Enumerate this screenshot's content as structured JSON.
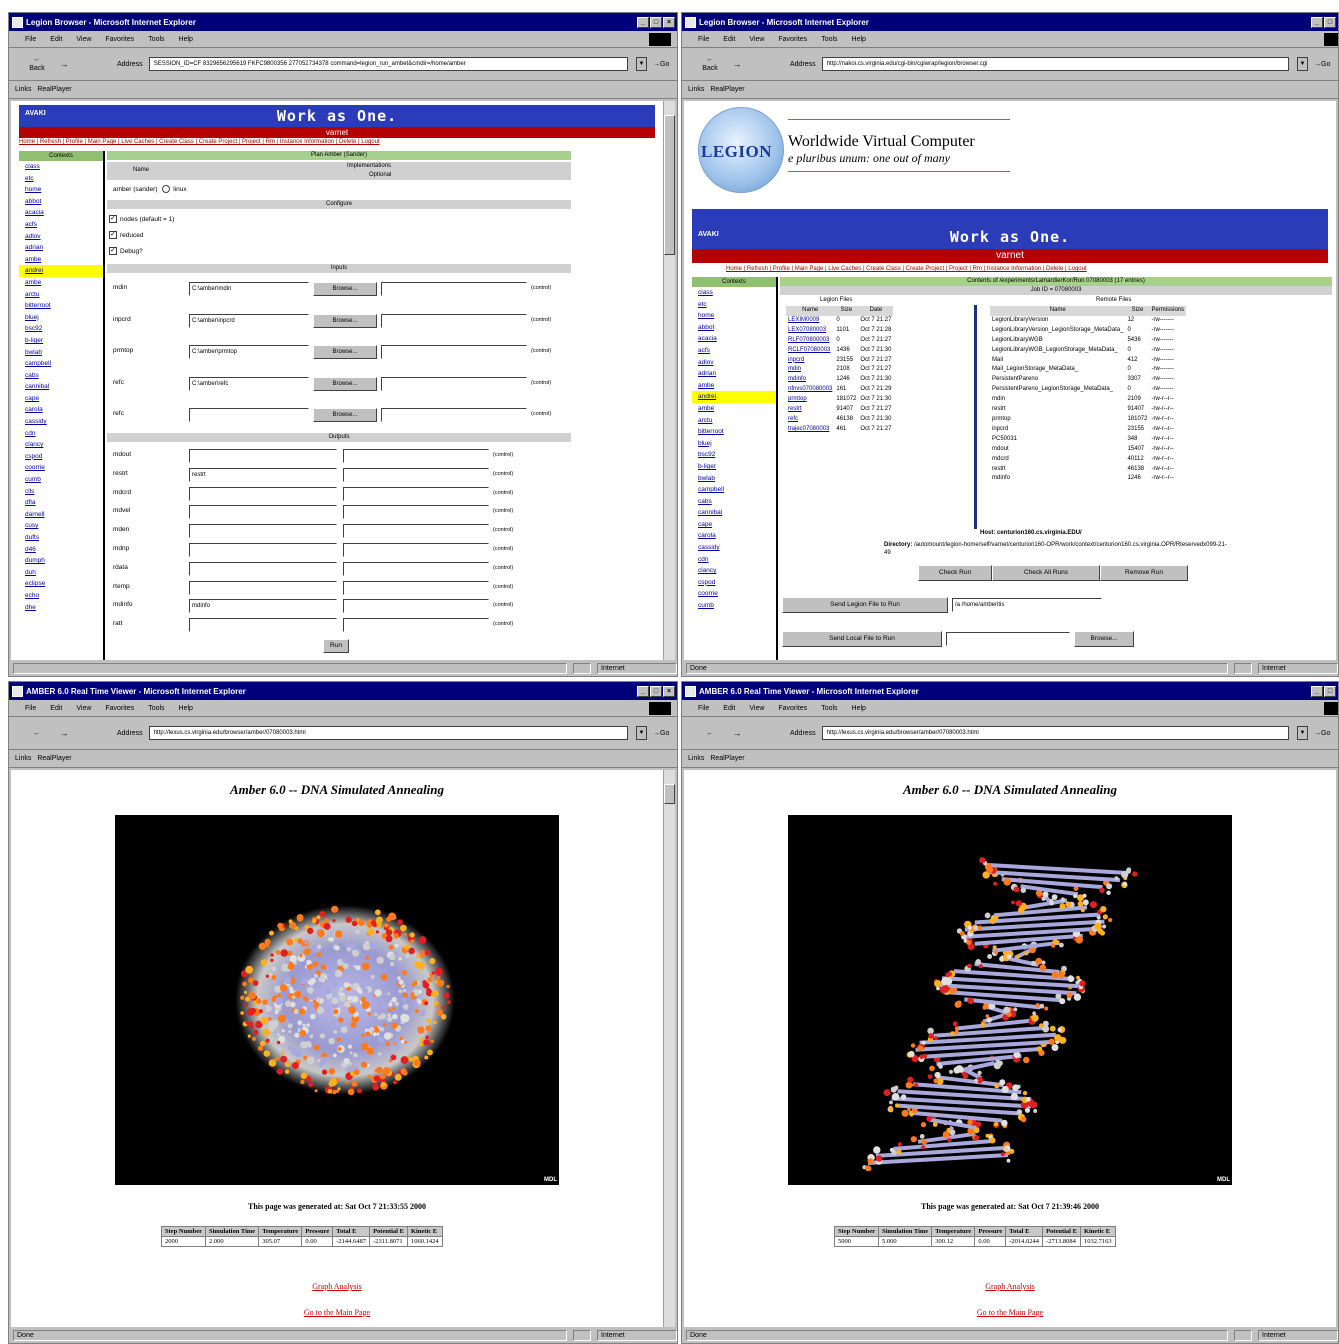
{
  "windows": {
    "w1": {
      "title": "Legion Browser - Microsoft Internet Explorer",
      "address": "SESSION_ID=CF 8329656295619 FKFC9800356 277052734378 command=legion_run_ambet&cmdir=/home/amber",
      "status": "",
      "zone": "Internet"
    },
    "w2": {
      "title": "Legion Browser - Microsoft Internet Explorer",
      "address": "http://nakoi.cs.virginia.edu/cgi-bin/cgiwrap/legion/browser.cgi",
      "status": "Done",
      "zone": "Internet"
    },
    "w3": {
      "title": "AMBER 6.0 Real Time Viewer - Microsoft Internet Explorer",
      "address": "http://lexus.cs.virginia.edu/browser/amber/07080003.html",
      "status": "Done",
      "zone": "Internet"
    },
    "w4": {
      "title": "AMBER 6.0 Real Time Viewer - Microsoft Internet Explorer",
      "address": "http://lexus.cs.virginia.edu/browser/amber/07080003.html",
      "status": "Done",
      "zone": "Internet"
    }
  },
  "menu": [
    "File",
    "Edit",
    "View",
    "Favorites",
    "Tools",
    "Help"
  ],
  "toolbar": {
    "back": "Back",
    "forward": "→",
    "address_label": "Address",
    "go": "Go"
  },
  "links_bar": {
    "links_label": "Links",
    "realplayer": "RealPlayer"
  },
  "legion": {
    "banner_logo": "AVAKI",
    "banner_title": "Work as One.",
    "subbanner": "varnet",
    "navlinks": "Home | Refresh | Profile | Main Page | Live Caches | Create Class | Create Project | Project | Rm | Instance Information | Delete | Logout",
    "contexts_label": "Contexts",
    "sidebar_items": [
      "class",
      "etc",
      "home",
      "abbot",
      "acacia",
      "acfs",
      "adlov",
      "adrian",
      "ambe",
      "andrei",
      "ambe",
      "arctu",
      "bitterroot",
      "bluej",
      "bsc92",
      "b-liger",
      "bwlab",
      "campbell",
      "cabs",
      "cannibal",
      "cape",
      "carola",
      "cassidy",
      "cdn",
      "clancy",
      "cspod",
      "coorrie",
      "cumb",
      "clls",
      "dfla",
      "darnell",
      "cusy",
      "dufts",
      "d46",
      "dumph",
      "duh",
      "eclipse",
      "echo",
      "dhe"
    ],
    "sidebar_selected": 9,
    "header_bar": "Plan Amber (Sander)",
    "name_label": "Name",
    "impl_label": "Implementations",
    "impl_sub": "Optional",
    "impl_value": "amber (sander)",
    "linux_label": "linux",
    "configure_label": "Configure",
    "configure_options": [
      {
        "checked": true,
        "label": "nodes (default = 1)"
      },
      {
        "checked": true,
        "label": "reduced"
      },
      {
        "checked": true,
        "label": "Debug?"
      }
    ],
    "inputs_label": "Inputs",
    "inputs": [
      {
        "name": "mdin",
        "value": "C:\\amber\\mdin"
      },
      {
        "name": "inpcrd",
        "value": "C:\\amber\\inpcrd"
      },
      {
        "name": "prmtop",
        "value": "C:\\amber\\prmtop"
      },
      {
        "name": "refc",
        "value": "C:\\amber\\refc"
      },
      {
        "name": "refc",
        "value": ""
      }
    ],
    "browse_label": "Browse...",
    "control_label": "(control)",
    "outputs_label": "Outputs",
    "outputs": [
      {
        "name": "mdout",
        "value": ""
      },
      {
        "name": "restrt",
        "value": "restrt"
      },
      {
        "name": "mdcrd",
        "value": ""
      },
      {
        "name": "mdvel",
        "value": ""
      },
      {
        "name": "mden",
        "value": ""
      },
      {
        "name": "mdnp",
        "value": ""
      },
      {
        "name": "rdata",
        "value": ""
      },
      {
        "name": "rtemp",
        "value": ""
      },
      {
        "name": "mdinfo",
        "value": "mdinfo"
      },
      {
        "name": "ratt",
        "value": ""
      }
    ],
    "run_button": "Run"
  },
  "legion2": {
    "logo_text": "LEGION",
    "heading": "Worldwide Virtual Computer",
    "motto": "e pluribus unum: one out of many",
    "contents_bar": "Contents of /experiments/LamardierKor/Run 07080003 (17 entries)",
    "job_bar": "Job ID = 07080003",
    "legion_files_label": "Legion Files",
    "remote_files_label": "Remote Files",
    "legion_cols": [
      "Name",
      "Size",
      "Date"
    ],
    "legion_files": [
      [
        "LEXIM0009",
        "0",
        "Oct 7 21:27"
      ],
      [
        "LEX07080003",
        "1101",
        "Oct 7 21:28"
      ],
      [
        "RLF070800003",
        "0",
        "Oct 7 21:27"
      ],
      [
        "RCLF07080003",
        "1436",
        "Oct 7 21:30"
      ],
      [
        "inpcrd",
        "23155",
        "Oct 7 21:27"
      ],
      [
        "mdin",
        "2108",
        "Oct 7 21:27"
      ],
      [
        "mdinfo",
        "1246",
        "Oct 7 21:30"
      ],
      [
        "nfnvs070080003",
        "161",
        "Oct 7 21:29"
      ],
      [
        "prmtop",
        "181072",
        "Oct 7 21:30"
      ],
      [
        "restrt",
        "91407",
        "Oct 7 21:27"
      ],
      [
        "refc",
        "46138",
        "Oct 7 21:30"
      ],
      [
        "trajec07080003",
        "461",
        "Oct 7 21:27"
      ]
    ],
    "remote_cols": [
      "Name",
      "Size",
      "Permissions"
    ],
    "remote_files": [
      [
        "LegionLibraryVersion",
        "12",
        "-rw-------"
      ],
      [
        "LegionLibraryVersion_LegionStorage_MetaData_",
        "0",
        "-rw-------"
      ],
      [
        "LegionLibraryWGB",
        "5436",
        "-rw-------"
      ],
      [
        "LegionLibraryWGB_LegionStorage_MetaData_",
        "0",
        "-rw-------"
      ],
      [
        "Mail",
        "412",
        "-rw-------"
      ],
      [
        "Mail_LegionStorage_MetaData_",
        "0",
        "-rw-------"
      ],
      [
        "PersistentPareno",
        "3307",
        "-rw-------"
      ],
      [
        "PersistentPareno_LegionStorage_MetaData_",
        "0",
        "-rw-------"
      ],
      [
        "mdin",
        "2109",
        "-rw-r--r--"
      ],
      [
        "restrt",
        "91407",
        "-rw-r--r--"
      ],
      [
        "prmtop",
        "181072",
        "-rw-r--r--"
      ],
      [
        "inpcrd",
        "23155",
        "-rw-r--r--"
      ],
      [
        "PC50031",
        "348",
        "-rw-r--r--"
      ],
      [
        "mdout",
        "15407",
        "-rw-r--r--"
      ],
      [
        "mdcrd",
        "40112",
        "-rw-r--r--"
      ],
      [
        "restrt",
        "46138",
        "-rw-r--r--"
      ],
      [
        "mdinfo",
        "1246",
        "-rw-r--r--"
      ]
    ],
    "host_line": "Host: centurion160.cs.virginia.EDU/",
    "dir_label": "Directory:",
    "dir_path": "/automount/legion-home/self/varnet/centurion160-OPR/work/context/centurion160.cs.virginia.OPR/Rteservedx099-21-49",
    "buttons": [
      "Check Run",
      "Check All Runs",
      "Remove Run"
    ],
    "send_legion_label": "Send Legion File to Run",
    "send_legion_value": "/a /home/amberitis",
    "send_local_label": "Send Local File to Run",
    "browse_label": "Browse..."
  },
  "amber": {
    "page_title": "Amber 6.0 -- DNA Simulated Annealing",
    "mdl_label": "MDL",
    "columns": [
      "Step Number",
      "Simulation Time",
      "Temperature",
      "Pressure",
      "Total E",
      "Potential E",
      "Kinetic E"
    ],
    "row_left": [
      "2000",
      "2.000",
      "305.07",
      "0.00",
      "-2144.6487",
      "-2311.8071",
      "1060.1424"
    ],
    "row_right": [
      "5000",
      "5.000",
      "300.12",
      "0.00",
      "-2014.0244",
      "-2713.8084",
      "1032.7163"
    ],
    "gen_left": "This page was generated at: Sat Oct 7 21:33:55 2000",
    "gen_right": "This page was generated at: Sat Oct 7 21:39:46 2000",
    "link1": "Graph Analysis",
    "link2": "Go to the Main Page"
  }
}
